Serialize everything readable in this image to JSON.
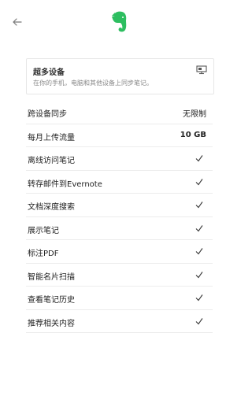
{
  "header": {
    "back_icon": "arrow-left-icon",
    "logo_icon": "evernote-elephant-icon",
    "brand_color": "#2dbe60"
  },
  "feature_card": {
    "title": "超多设备",
    "subtitle": "在你的手机，电脑和其他设备上同步笔记。",
    "icon": "monitor-icon"
  },
  "rows": [
    {
      "label": "跨设备同步",
      "value": "无限制",
      "type": "text"
    },
    {
      "label": "每月上传流量",
      "value": "10 GB",
      "type": "text-bold"
    },
    {
      "label": "离线访问笔记",
      "type": "check"
    },
    {
      "label": "转存邮件到Evernote",
      "type": "check"
    },
    {
      "label": "文档深度搜索",
      "type": "check"
    },
    {
      "label": "展示笔记",
      "type": "check"
    },
    {
      "label": "标注PDF",
      "type": "check"
    },
    {
      "label": "智能名片扫描",
      "type": "check"
    },
    {
      "label": "查看笔记历史",
      "type": "check"
    },
    {
      "label": "推荐相关内容",
      "type": "check"
    }
  ]
}
